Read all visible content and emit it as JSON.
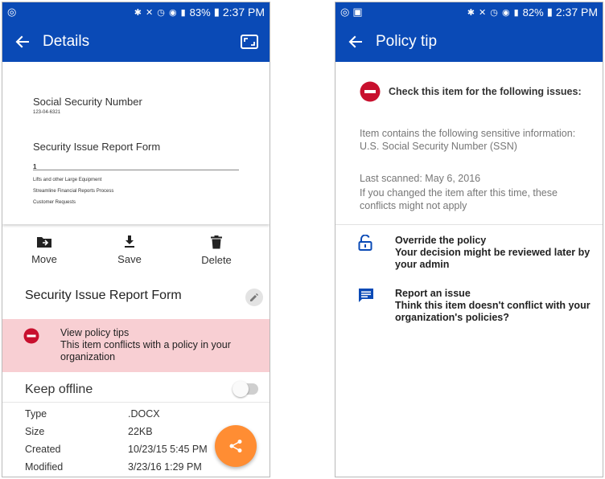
{
  "status_left": {
    "time": "2:37 PM",
    "battery": "83%"
  },
  "status_right": {
    "time": "2:37 PM",
    "battery": "82%"
  },
  "details": {
    "title": "Details",
    "doc": {
      "heading1": "Social Security Number",
      "heading1_small": "123-04-6321",
      "heading2": "Security Issue Report Form",
      "digit": "1",
      "lines": [
        "Lifts and other Large Equipment",
        "Streamline Financial Reports Process",
        "Customer Requests"
      ]
    },
    "actions": {
      "move": "Move",
      "save": "Save",
      "delete": "Delete"
    },
    "file_title": "Security Issue Report Form",
    "policy": {
      "title": "View policy tips",
      "body": "This item conflicts with a policy in your organization"
    },
    "keep_offline": "Keep offline",
    "properties": [
      {
        "key": "Type",
        "value": ".DOCX"
      },
      {
        "key": "Size",
        "value": "22KB"
      },
      {
        "key": "Created",
        "value": "10/23/15 5:45 PM"
      },
      {
        "key": "Modified",
        "value": "3/23/16 1:29 PM"
      }
    ]
  },
  "policy_tip": {
    "title": "Policy tip",
    "check_text": "Check this item for the following issues:",
    "sensitive": "Item contains the following sensitive information:  U.S. Social Security Number (SSN)",
    "last_scanned": "Last scanned: May 6, 2016",
    "changed_note": "If you changed the item after this time, these conflicts might not apply",
    "override": {
      "title": "Override the policy",
      "body": "Your decision might be reviewed later by your admin"
    },
    "report": {
      "title": "Report an issue",
      "body": "Think this item doesn't conflict with your organization's policies?"
    }
  },
  "colors": {
    "header": "#0a4ab6",
    "banner": "#f8cfd3",
    "fab": "#ff8d33",
    "stop": "#c8102e",
    "icon_blue": "#0a4ab6"
  }
}
